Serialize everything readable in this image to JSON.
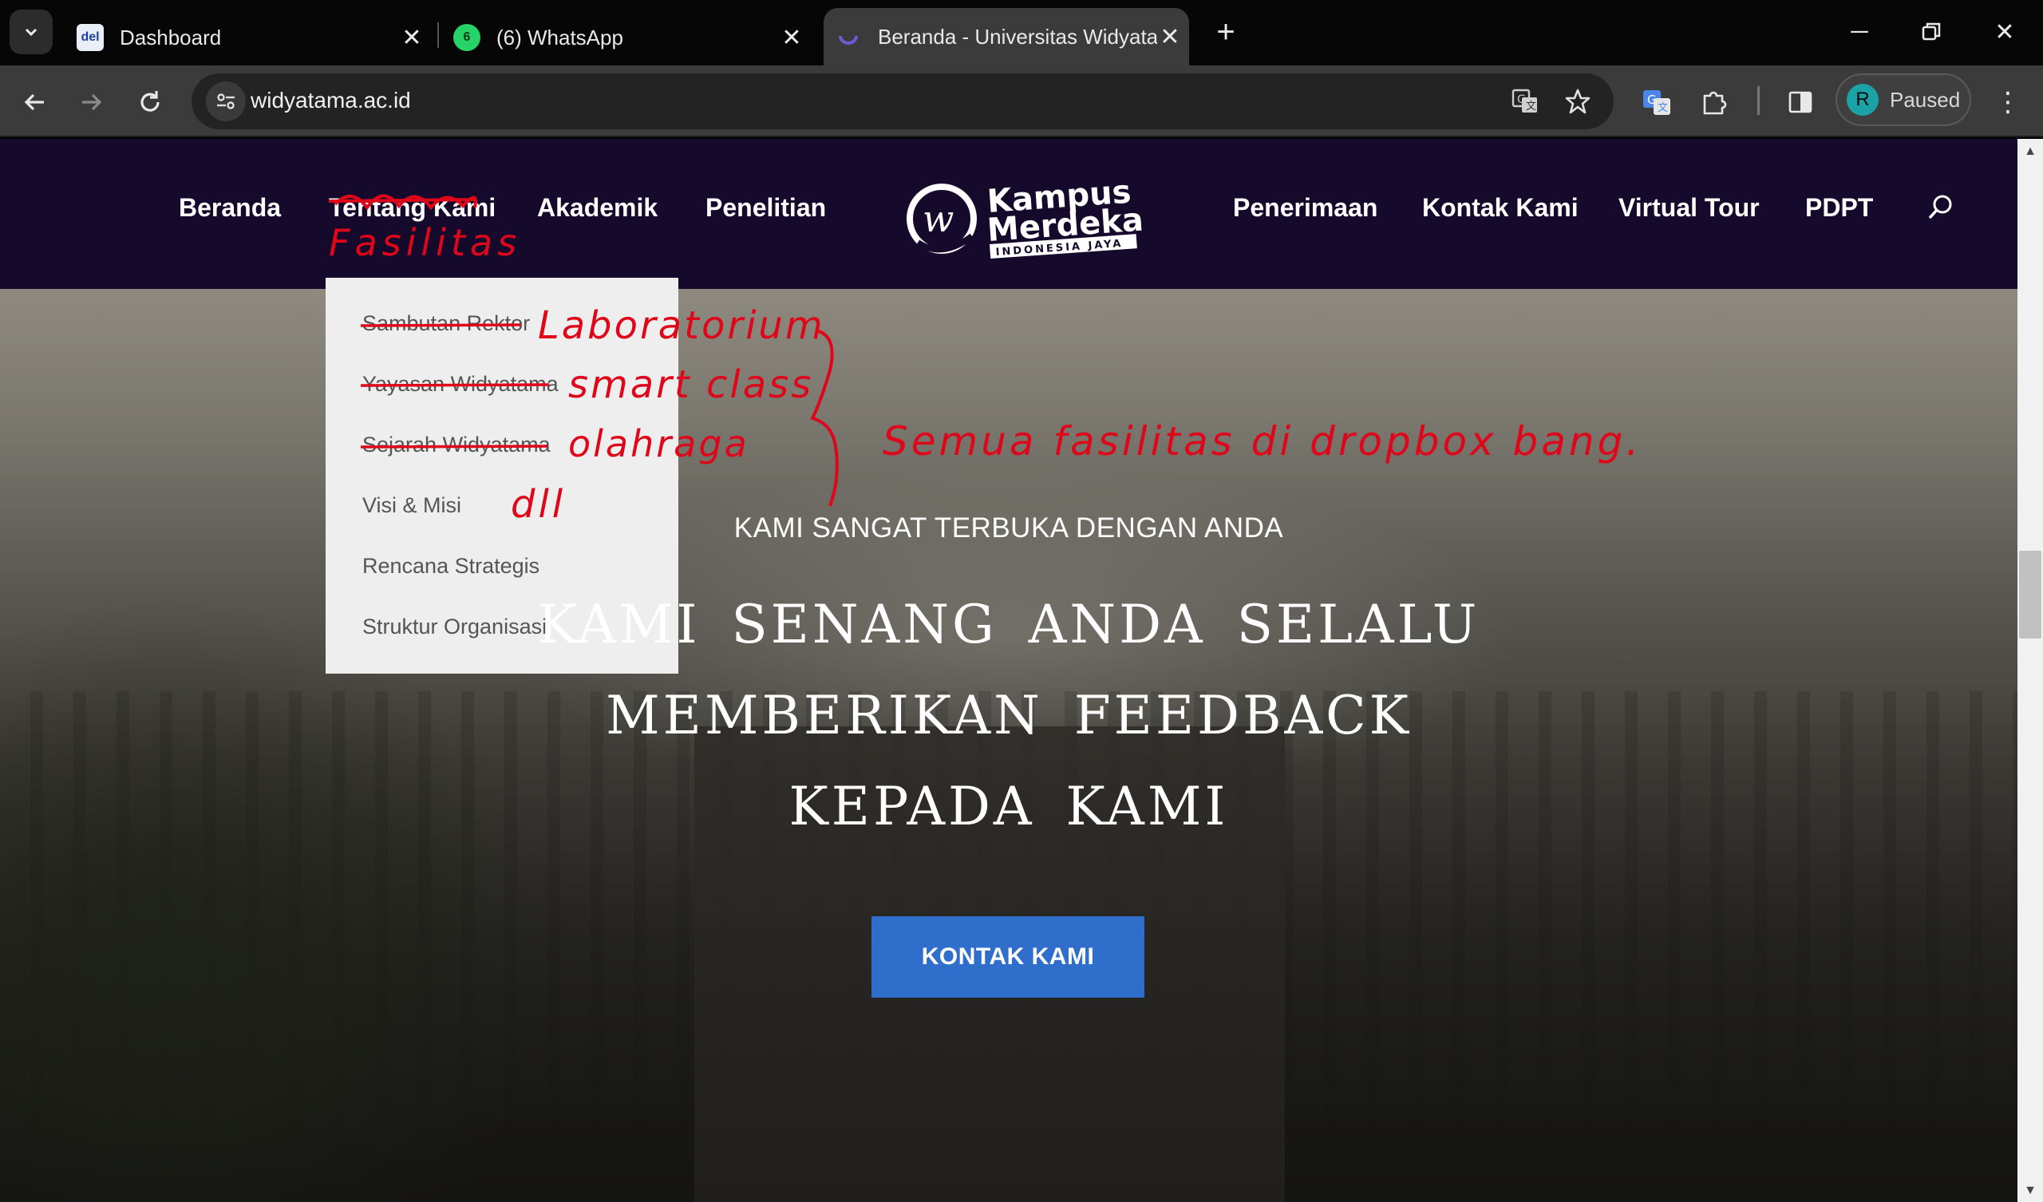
{
  "browser": {
    "tabs": [
      {
        "title": "Dashboard",
        "favicon": "del",
        "active": false
      },
      {
        "title": "(6) WhatsApp",
        "favicon": "6",
        "active": false
      },
      {
        "title": "Beranda - Universitas Widyatama",
        "active": true
      }
    ],
    "url": "widyatama.ac.id",
    "profile": {
      "initial": "R",
      "status": "Paused"
    },
    "colors": {
      "tabbar": "#060606",
      "toolbar": "#3b3b3b",
      "profile_avatar": "#1aa2a6"
    }
  },
  "site": {
    "nav_left": [
      "Beranda",
      "Tentang Kami",
      "Akademik",
      "Penelitian"
    ],
    "nav_right": [
      "Penerimaan",
      "Kontak Kami",
      "Virtual Tour",
      "PDPT"
    ],
    "logo": {
      "line1": "Kampus",
      "line2": "Merdeka",
      "tagline": "INDONESIA JAYA"
    },
    "dropdown": [
      "Sambutan Rektor",
      "Yayasan Widyatama",
      "Sejarah Widyatama",
      "Visi & Misi",
      "Rencana Strategis",
      "Struktur Organisasi"
    ],
    "hero": {
      "subtitle": "KAMI SANGAT TERBUKA DENGAN ANDA",
      "title_lines": [
        "KAMI SENANG ANDA SELALU",
        "MEMBERIKAN FEEDBACK",
        "KEPADA KAMI"
      ],
      "button": "KONTAK KAMI"
    },
    "colors": {
      "nav_bg": "#160a2c",
      "button": "#2f6fcb",
      "dropdown_bg": "#eeeeee"
    }
  },
  "annotations": {
    "replacement_menu": "Fasilitas",
    "items": [
      "Laboratorium",
      "smart class",
      "olahraga",
      "dll"
    ],
    "note": "Semua fasilitas di dropbox bang.",
    "color": "#e0061a"
  }
}
